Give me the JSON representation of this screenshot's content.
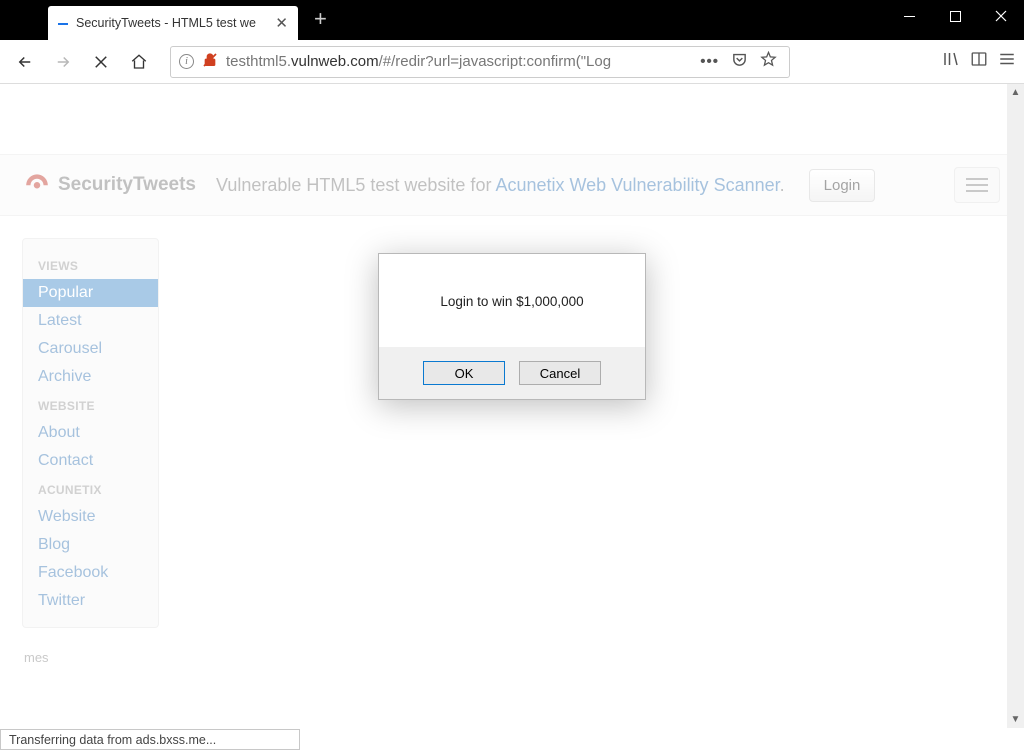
{
  "window": {
    "tab_title": "SecurityTweets - HTML5 test we"
  },
  "toolbar": {
    "url_pre": "testhtml5.",
    "url_host": "vulnweb.com",
    "url_path": "/#/redir?url=javascript:confirm(\"Log"
  },
  "page": {
    "brand": "SecurityTweets",
    "tagline_pre": "Vulnerable HTML5 test website for ",
    "tagline_link": "Acunetix Web Vulnerability Scanner",
    "tagline_post": ".",
    "login": "Login"
  },
  "sidebar": {
    "groups": [
      {
        "header": "VIEWS",
        "items": [
          {
            "label": "Popular",
            "active": true
          },
          {
            "label": "Latest"
          },
          {
            "label": "Carousel"
          },
          {
            "label": "Archive"
          }
        ]
      },
      {
        "header": "WEBSITE",
        "items": [
          {
            "label": "About"
          },
          {
            "label": "Contact"
          }
        ]
      },
      {
        "header": "ACUNETIX",
        "items": [
          {
            "label": "Website"
          },
          {
            "label": "Blog"
          },
          {
            "label": "Facebook"
          },
          {
            "label": "Twitter"
          }
        ]
      }
    ]
  },
  "footer": {
    "text": "mes"
  },
  "dialog": {
    "message": "Login to win $1,000,000",
    "ok": "OK",
    "cancel": "Cancel"
  },
  "status": {
    "text": "Transferring data from ads.bxss.me..."
  }
}
